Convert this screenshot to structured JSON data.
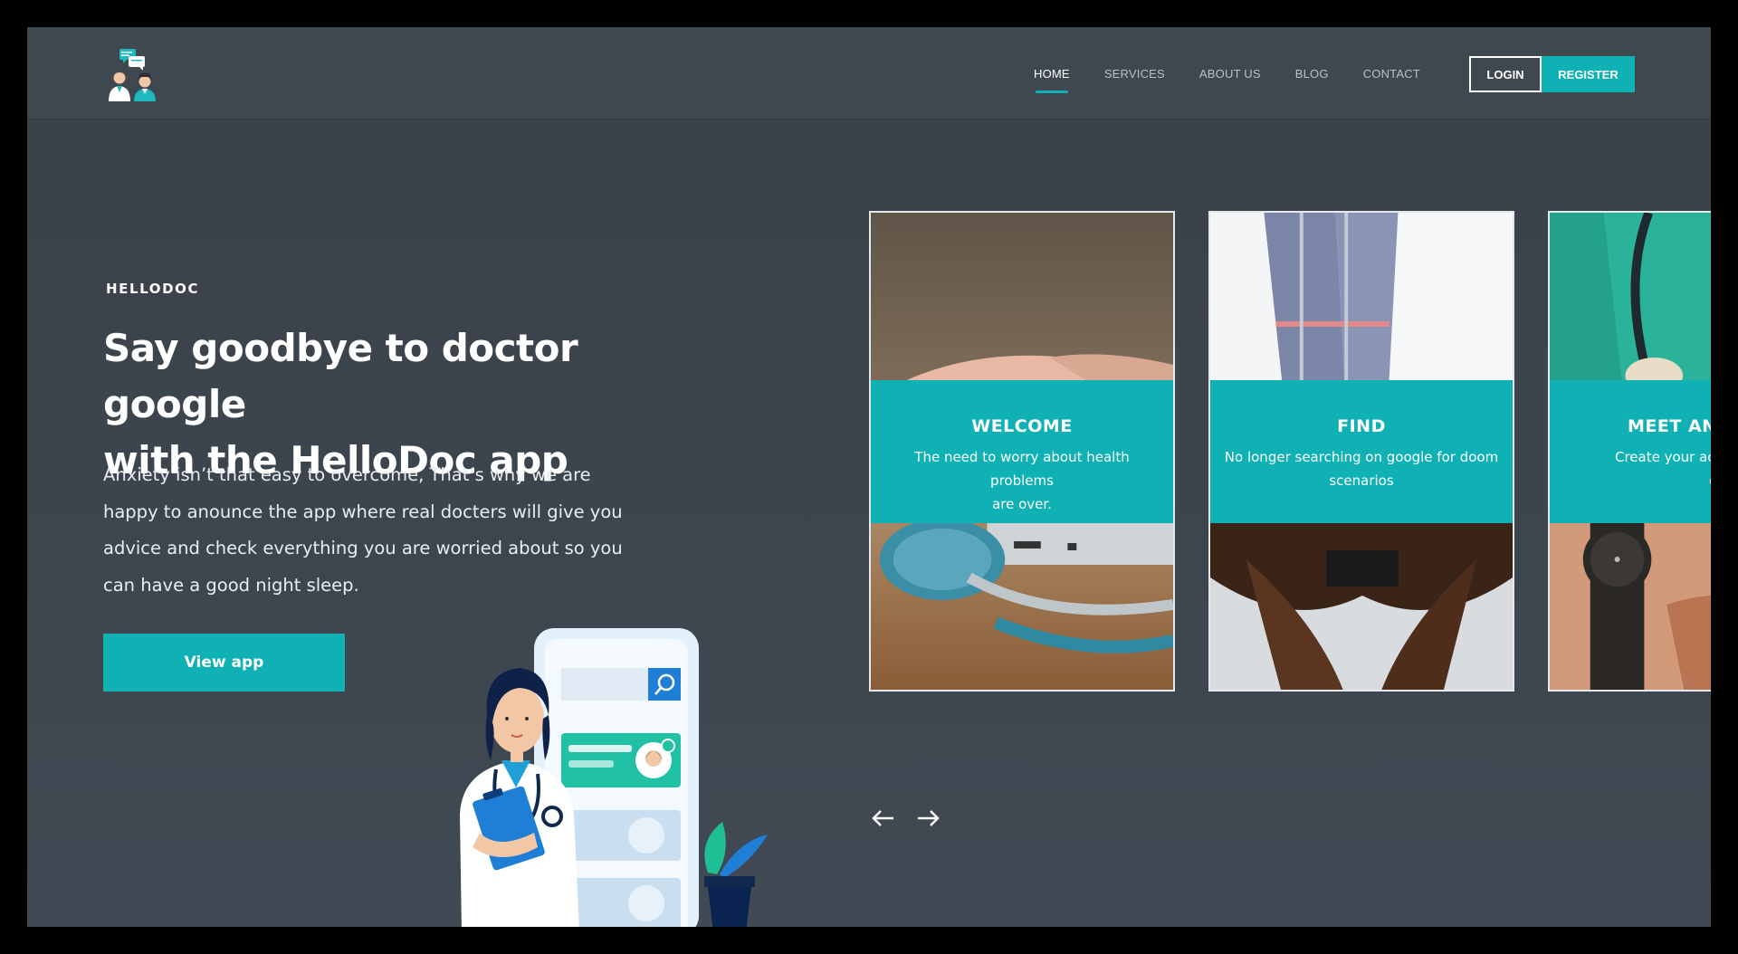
{
  "nav": {
    "items": [
      "HOME",
      "SERVICES",
      "ABOUT US",
      "BLOG",
      "CONTACT"
    ],
    "active": "HOME",
    "login_label": "LOGIN",
    "register_label": "REGISTER"
  },
  "hero": {
    "eyebrow": "HELLODOC",
    "title_line1": "Say goodbye to doctor google",
    "title_line2": "with the HelloDoc app",
    "text_line1": "Anxiety isn’t that easy to overcome, That’s why we are",
    "text_line2": "happy to anounce the app where real docters will give you",
    "text_line3": "advice and check everything you are worried about so you",
    "text_line4": "can have a good night sleep.",
    "button_label": "View app"
  },
  "cards": [
    {
      "title": "WELCOME",
      "line1": "The need to worry about health problems",
      "line2": "are over."
    },
    {
      "title": "FIND",
      "line1": "No longer searching on google for doom",
      "line2": "scenarios"
    },
    {
      "title": "MEET AN",
      "line1": "Create your accour",
      "line2": "doct"
    }
  ],
  "carousel": {
    "prev_icon": "arrow-left-icon",
    "next_icon": "arrow-right-icon"
  },
  "colors": {
    "accent": "#0fb1b4",
    "background": "#3d454e",
    "navbar": "#3f474f"
  }
}
